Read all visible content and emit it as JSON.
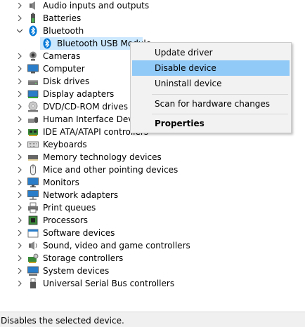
{
  "tree": {
    "items": [
      {
        "label": "Audio inputs and outputs",
        "icon": "speaker-icon",
        "expanded": false
      },
      {
        "label": "Batteries",
        "icon": "battery-icon",
        "expanded": false
      },
      {
        "label": "Bluetooth",
        "icon": "bluetooth-icon",
        "expanded": true,
        "children": [
          {
            "label": "Bluetooth USB Module",
            "icon": "bluetooth-icon",
            "selected": true
          }
        ]
      },
      {
        "label": "Cameras",
        "icon": "camera-icon",
        "expanded": false
      },
      {
        "label": "Computer",
        "icon": "computer-icon",
        "expanded": false
      },
      {
        "label": "Disk drives",
        "icon": "disk-drive-icon",
        "expanded": false
      },
      {
        "label": "Display adapters",
        "icon": "display-adapter-icon",
        "expanded": false
      },
      {
        "label": "DVD/CD-ROM drives",
        "icon": "dvd-drive-icon",
        "expanded": false
      },
      {
        "label": "Human Interface Devices",
        "icon": "hid-icon",
        "expanded": false
      },
      {
        "label": "IDE ATA/ATAPI controllers",
        "icon": "ide-controller-icon",
        "expanded": false
      },
      {
        "label": "Keyboards",
        "icon": "keyboard-icon",
        "expanded": false
      },
      {
        "label": "Memory technology devices",
        "icon": "memory-icon",
        "expanded": false
      },
      {
        "label": "Mice and other pointing devices",
        "icon": "mouse-icon",
        "expanded": false
      },
      {
        "label": "Monitors",
        "icon": "monitor-icon",
        "expanded": false
      },
      {
        "label": "Network adapters",
        "icon": "network-adapter-icon",
        "expanded": false
      },
      {
        "label": "Print queues",
        "icon": "printer-icon",
        "expanded": false
      },
      {
        "label": "Processors",
        "icon": "processor-icon",
        "expanded": false
      },
      {
        "label": "Software devices",
        "icon": "software-device-icon",
        "expanded": false
      },
      {
        "label": "Sound, video and game controllers",
        "icon": "sound-icon",
        "expanded": false
      },
      {
        "label": "Storage controllers",
        "icon": "storage-controller-icon",
        "expanded": false
      },
      {
        "label": "System devices",
        "icon": "system-device-icon",
        "expanded": false
      },
      {
        "label": "Universal Serial Bus controllers",
        "icon": "usb-icon",
        "expanded": false
      }
    ]
  },
  "context_menu": {
    "items": [
      {
        "label": "Update driver"
      },
      {
        "label": "Disable device",
        "highlighted": true
      },
      {
        "label": "Uninstall device"
      },
      {
        "label": "Scan for hardware changes"
      },
      {
        "label": "Properties",
        "bold": true
      }
    ]
  },
  "status_bar": {
    "text": "Disables the selected device."
  },
  "colors": {
    "selection": "#cce8ff",
    "menu_highlight": "#91c9f7",
    "menu_background": "#f2f2f2",
    "bluetooth_blue": "#0078d7"
  }
}
